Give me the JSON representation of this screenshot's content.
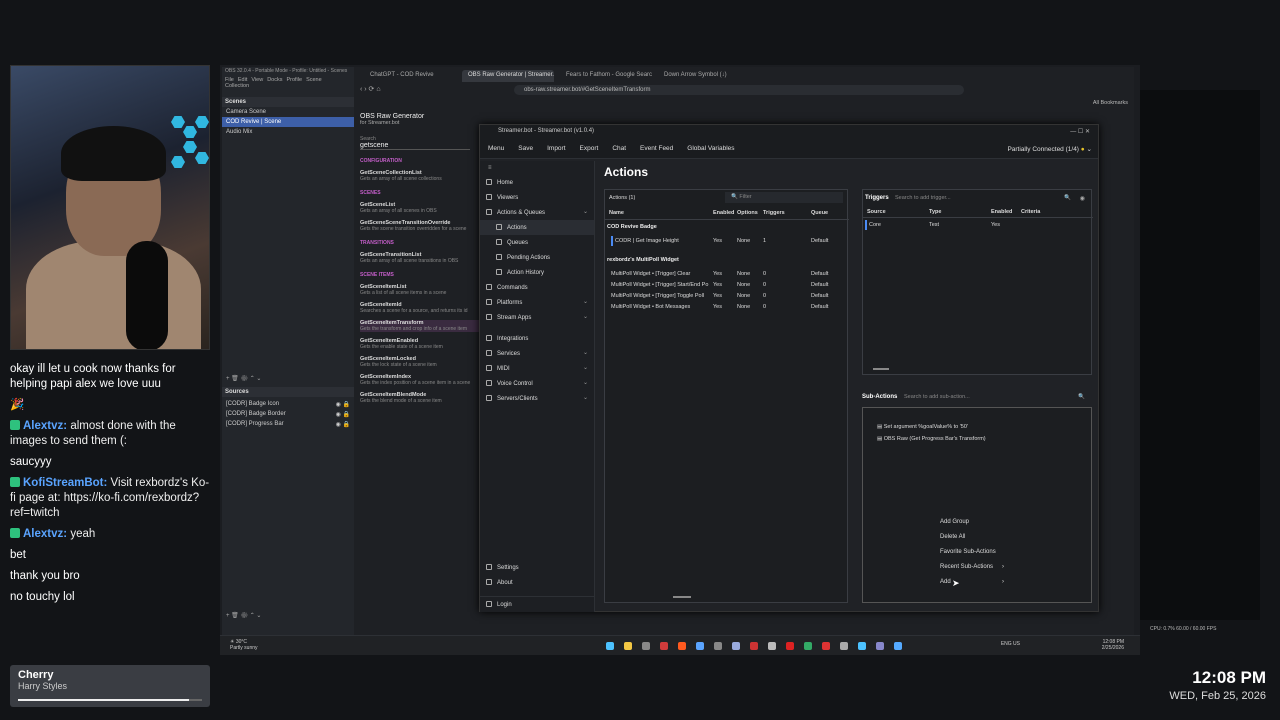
{
  "chat": {
    "messages": [
      {
        "user": "",
        "text": "okay ill let u cook now thanks for helping papi alex we love uuu",
        "color": "#ffffff"
      },
      {
        "user": "",
        "text": "🎉",
        "color": "#b67cff"
      },
      {
        "user": "Alextvz:",
        "text": "almost done with the images to send them (:",
        "color": "#5aa4ff"
      },
      {
        "user": "",
        "text": "saucyyy",
        "color": "#ffffff"
      },
      {
        "user": "KofiStreamBot:",
        "text": "Visit rexbordz's Ko-fi page at: https://ko-fi.com/rexbordz?ref=twitch",
        "color": "#5aa4ff"
      },
      {
        "user": "Alextvz:",
        "text": "yeah",
        "color": "#5aa4ff"
      },
      {
        "user": "",
        "text": "bet",
        "color": "#ffffff"
      },
      {
        "user": "",
        "text": "thank you bro",
        "color": "#ffffff"
      },
      {
        "user": "",
        "text": "no touchy lol",
        "color": "#ffffff"
      }
    ]
  },
  "music": {
    "title": "Cherry",
    "artist": "Harry Styles",
    "progress": 0.93
  },
  "clock": {
    "time": "12:08 PM",
    "date": "WED, Feb 25, 2026"
  },
  "obs": {
    "title": "OBS 32.0.4 - Portable Mode - Profile: Untitled - Scenes",
    "menu": [
      "File",
      "Edit",
      "View",
      "Docks",
      "Profile",
      "Scene Collection"
    ],
    "scenes_header": "Scenes",
    "scenes": [
      "Camera Scene",
      "COD Revive | Scene",
      "Audio Mix"
    ],
    "selected_scene": 1,
    "sources_header": "Sources",
    "sources": [
      "[CODR] Badge Icon",
      "[CODR] Badge Border",
      "[CODR] Progress Bar"
    ]
  },
  "browser": {
    "tabs": [
      "ChatGPT - COD Revive",
      "OBS Raw Generator | Streamer.b",
      "Fears to Fathom - Google Search",
      "Down Arrow Symbol (↓)"
    ],
    "active_tab": 1,
    "url": "obs-raw.streamer.bot/#GetSceneItemTransform",
    "bookmarks": "All Bookmarks"
  },
  "rawgen": {
    "title": "OBS Raw Generator",
    "subtitle": "for Streamer.bot",
    "search_label": "Search",
    "search_value": "getscene",
    "sections": [
      {
        "name": "CONFIGURATION",
        "items": [
          {
            "name": "GetSceneCollectionList",
            "desc": "Gets an array of all scene collections"
          }
        ]
      },
      {
        "name": "SCENES",
        "items": [
          {
            "name": "GetSceneList",
            "desc": "Gets an array of all scenes in OBS"
          },
          {
            "name": "GetSceneSceneTransitionOverride",
            "desc": "Gets the scene transition overridden for a scene"
          }
        ]
      },
      {
        "name": "TRANSITIONS",
        "items": [
          {
            "name": "GetSceneTransitionList",
            "desc": "Gets an array of all scene transitions in OBS"
          }
        ]
      },
      {
        "name": "SCENE ITEMS",
        "items": [
          {
            "name": "GetSceneItemList",
            "desc": "Gets a list of all scene items in a scene"
          },
          {
            "name": "GetSceneItemId",
            "desc": "Searches a scene for a source, and returns its id"
          },
          {
            "name": "GetSceneItemTransform",
            "desc": "Gets the transform and crop info of a scene item"
          },
          {
            "name": "GetSceneItemEnabled",
            "desc": "Gets the enable state of a scene item"
          },
          {
            "name": "GetSceneItemLocked",
            "desc": "Gets the lock state of a scene item"
          },
          {
            "name": "GetSceneItemIndex",
            "desc": "Gets the index position of a scene item in a scene"
          },
          {
            "name": "GetSceneItemBlendMode",
            "desc": "Gets the blend mode of a scene item"
          }
        ]
      }
    ]
  },
  "sb": {
    "title": "Streamer.bot - Streamer.bot (v1.0.4)",
    "toolbar": [
      "Menu",
      "Save",
      "Import",
      "Export",
      "Chat",
      "Event Feed",
      "Global Variables"
    ],
    "status": "Partially Connected (1/4)",
    "nav": [
      {
        "label": "Home",
        "sub": false,
        "chev": false
      },
      {
        "label": "Viewers",
        "sub": false,
        "chev": false
      },
      {
        "label": "Actions & Queues",
        "sub": false,
        "chev": true
      },
      {
        "label": "Actions",
        "sub": true,
        "chev": false,
        "sel": true
      },
      {
        "label": "Queues",
        "sub": true,
        "chev": false
      },
      {
        "label": "Pending Actions",
        "sub": true,
        "chev": false
      },
      {
        "label": "Action History",
        "sub": true,
        "chev": false
      },
      {
        "label": "Commands",
        "sub": false,
        "chev": false
      },
      {
        "label": "Platforms",
        "sub": false,
        "chev": true
      },
      {
        "label": "Stream Apps",
        "sub": false,
        "chev": true
      },
      {
        "label": "Integrations",
        "sub": false,
        "chev": false
      },
      {
        "label": "Services",
        "sub": false,
        "chev": true
      },
      {
        "label": "MIDI",
        "sub": false,
        "chev": true
      },
      {
        "label": "Voice Control",
        "sub": false,
        "chev": true
      },
      {
        "label": "Servers/Clients",
        "sub": false,
        "chev": true
      }
    ],
    "nav_bottom": [
      "Settings",
      "About",
      "Login"
    ],
    "page_title": "Actions",
    "actions_label": "Actions (1)",
    "filter_placeholder": "Filter",
    "columns": [
      "Name",
      "Enabled",
      "Options",
      "Triggers",
      "Queue"
    ],
    "groups": [
      {
        "name": "COD Revive Badge",
        "rows": [
          [
            "CODR | Get Image Height",
            "Yes",
            "None",
            "1",
            "Default"
          ]
        ]
      },
      {
        "name": "rexbordz's MultiPoll Widget",
        "rows": [
          [
            "MultiPoll Widget • [Trigger] Clear",
            "Yes",
            "None",
            "0",
            "Default"
          ],
          [
            "MultiPoll Widget • [Trigger] Start/End Po",
            "Yes",
            "None",
            "0",
            "Default"
          ],
          [
            "MultiPoll Widget • [Trigger] Toggle Poll",
            "Yes",
            "None",
            "0",
            "Default"
          ],
          [
            "MultiPoll Widget • Bot Messages",
            "Yes",
            "None",
            "0",
            "Default"
          ]
        ]
      }
    ],
    "triggers_label": "Triggers",
    "triggers_search": "Search to add trigger...",
    "trigger_columns": [
      "Source",
      "Type",
      "Enabled",
      "Criteria"
    ],
    "trigger_rows": [
      [
        "Core",
        "Test",
        "Yes",
        ""
      ]
    ],
    "subactions_label": "Sub-Actions",
    "subactions_search": "Search to add sub-action...",
    "subactions": [
      "Set argument %goalValue% to '50'",
      "OBS Raw (Get Progress Bar's Transform)"
    ],
    "context_menu": [
      {
        "label": "Add Group",
        "arrow": ""
      },
      {
        "label": "Delete All",
        "arrow": ""
      },
      {
        "label": "Favorite Sub-Actions",
        "arrow": ""
      },
      {
        "label": "Recent Sub-Actions",
        "arrow": "›"
      },
      {
        "label": "Add",
        "arrow": "›"
      }
    ]
  },
  "taskbar": {
    "weather_temp": "30°C",
    "weather_text": "Partly sunny",
    "lang": "ENG US",
    "time": "12:08 PM",
    "date": "2/25/2026"
  },
  "obs_status": {
    "cpu": "CPU: 0.7%",
    "fps": "60.00 / 60.00 FPS"
  }
}
